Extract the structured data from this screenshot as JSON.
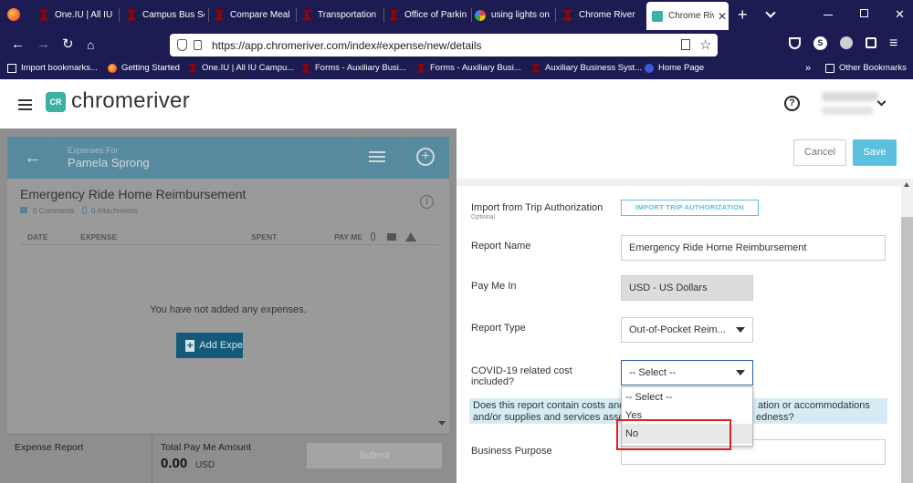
{
  "browser": {
    "tabs": [
      {
        "title": "One.IU | All IU",
        "icon": "iu-trident-icon"
      },
      {
        "title": "Campus Bus Se",
        "icon": "iu-trident-icon"
      },
      {
        "title": "Compare Meal",
        "icon": "iu-trident-icon"
      },
      {
        "title": "Transportation",
        "icon": "iu-trident-icon"
      },
      {
        "title": "Office of Parkin",
        "icon": "iu-trident-icon"
      },
      {
        "title": "using lights on",
        "icon": "google-icon"
      },
      {
        "title": "Chrome River",
        "icon": "iu-trident-icon"
      },
      {
        "title": "Chrome Rive",
        "icon": "chromeriver-icon"
      }
    ],
    "url": "https://app.chromeriver.com/index#expense/new/details",
    "bookmarks": [
      "Import bookmarks...",
      "Getting Started",
      "One.IU | All IU Campu...",
      "Forms - Auxiliary Busi...",
      "Forms - Auxiliary Busi...",
      "Auxiliary Business Syst...",
      "Home Page"
    ],
    "other_bookmarks": "Other Bookmarks",
    "profile_letter": "S"
  },
  "app": {
    "logo_badge": "CR",
    "logo_text": "chromeriver",
    "help": "?"
  },
  "left": {
    "expenses_for_label": "Expenses For",
    "person": "Pamela Sprong",
    "report_title": "Emergency Ride Home Reimbursement",
    "comments": "0 Comments",
    "attachments": "0 Attachments",
    "columns": [
      "DATE",
      "EXPENSE",
      "SPENT",
      "PAY ME"
    ],
    "empty_message": "You have not added any expenses.",
    "add_button": "Add Expe",
    "footer_report_label": "Expense Report",
    "footer_total_label": "Total Pay Me Amount",
    "footer_amount": "0.00",
    "footer_currency": "USD",
    "submit": "Submit"
  },
  "right": {
    "cancel": "Cancel",
    "save": "Save",
    "import_label": "Import from Trip Authorization",
    "import_optional": "Optional",
    "import_button": "IMPORT TRIP AUTHORIZATION",
    "report_name_label": "Report Name",
    "report_name_value": "Emergency Ride Home Reimbursement",
    "pay_me_in_label": "Pay Me In",
    "pay_me_in_value": "USD - US Dollars",
    "report_type_label": "Report Type",
    "report_type_value": "Out-of-Pocket Reim...",
    "covid_label_1": "COVID-19 related cost",
    "covid_label_2": "included?",
    "covid_value": "-- Select --",
    "covid_options": [
      "-- Select --",
      "Yes",
      "No"
    ],
    "info_line_1_a": "Does this report contain costs and",
    "info_line_1_b": "ation or accommodations",
    "info_line_2_a": "and/or supplies and services asso",
    "info_line_2_b": "edness?",
    "business_purpose_label": "Business Purpose"
  }
}
